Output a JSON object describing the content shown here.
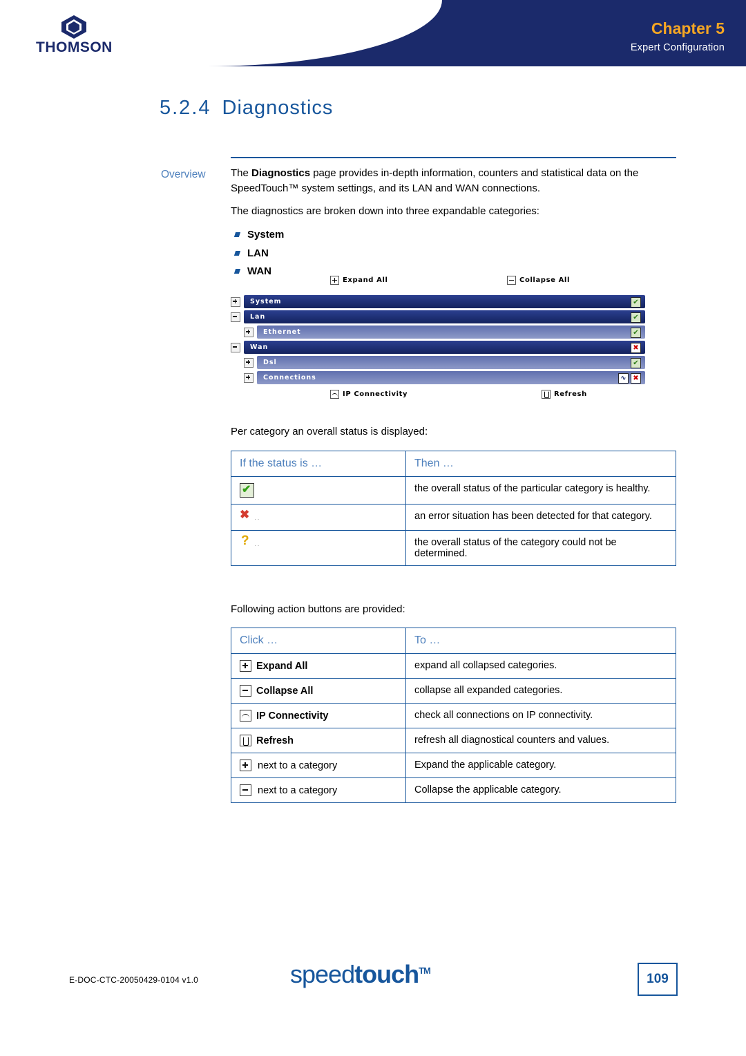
{
  "header": {
    "brand": "THOMSON",
    "chapter_label": "Chapter",
    "chapter_number": "5",
    "chapter_subtitle": "Expert Configuration",
    "brand_color": "#1b2a6b",
    "accent_color": "#f5a623"
  },
  "section": {
    "number": "5.2.4",
    "title": "Diagnostics",
    "label": "Overview",
    "accent_color": "#17569c"
  },
  "overview": {
    "para1_pre": "The ",
    "para1_bold": "Diagnostics",
    "para1_post": " page provides in-depth information, counters and statistical data on the SpeedTouch™ system settings, and its LAN and WAN connections.",
    "para2": "The diagnostics are broken down into three expandable categories:",
    "bullets": [
      "System",
      "LAN",
      "WAN"
    ],
    "para3": "Per category an overall status is displayed:",
    "para4": "Following action buttons are provided:"
  },
  "screenshot": {
    "expand_all": "Expand All",
    "collapse_all": "Collapse All",
    "ip_connectivity": "IP Connectivity",
    "refresh": "Refresh",
    "rows": [
      {
        "label": "System",
        "toggle": "plus",
        "indent": 0,
        "style": "dark",
        "status": [
          "ok"
        ]
      },
      {
        "label": "Lan",
        "toggle": "minus",
        "indent": 0,
        "style": "dark",
        "status": [
          "ok"
        ]
      },
      {
        "label": "Ethernet",
        "toggle": "plus",
        "indent": 1,
        "style": "light",
        "status": [
          "ok"
        ]
      },
      {
        "label": "Wan",
        "toggle": "minus",
        "indent": 0,
        "style": "dark",
        "status": [
          "err"
        ]
      },
      {
        "label": "Dsl",
        "toggle": "plus",
        "indent": 1,
        "style": "light",
        "status": [
          "ok"
        ]
      },
      {
        "label": "Connections",
        "toggle": "plus",
        "indent": 1,
        "style": "light",
        "status": [
          "err2",
          "err"
        ]
      }
    ]
  },
  "status_table": {
    "header_left": "If the status is …",
    "header_right": "Then …",
    "rows": [
      {
        "icon": "status-ok-icon",
        "text": "the overall status of the particular category is healthy."
      },
      {
        "icon": "status-error-icon",
        "text": "an error situation has been detected for that category."
      },
      {
        "icon": "status-unknown-icon",
        "text": "the overall status of the category could not be determined."
      }
    ]
  },
  "actions_table": {
    "header_left": "Click …",
    "header_right": "To …",
    "rows": [
      {
        "icon": "plus",
        "label": "Expand All",
        "text": "expand all collapsed categories."
      },
      {
        "icon": "minus",
        "label": "Collapse All",
        "text": "collapse all expanded categories."
      },
      {
        "icon": "wave",
        "label": "IP Connectivity",
        "text": "check all connections on IP connectivity."
      },
      {
        "icon": "refresh",
        "label": "Refresh",
        "text": "refresh all diagnostical counters and values."
      },
      {
        "icon": "plus",
        "label": "next to a category",
        "text": "Expand the applicable category.",
        "plain": true
      },
      {
        "icon": "minus",
        "label": "next to a category",
        "text": "Collapse the applicable category.",
        "plain": true
      }
    ]
  },
  "footer": {
    "doc_id": "E-DOC-CTC-20050429-0104 v1.0",
    "logo_light": "speed",
    "logo_bold": "touch",
    "logo_tm": "TM",
    "page_number": "109"
  }
}
